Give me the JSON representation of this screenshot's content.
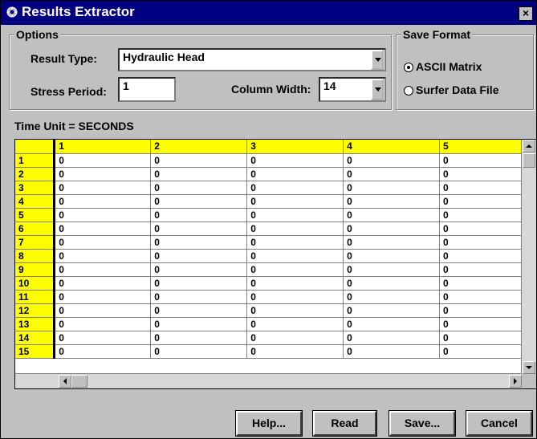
{
  "window": {
    "title": "Results Extractor",
    "close_glyph": "×"
  },
  "options": {
    "group_label": "Options",
    "result_type_label": "Result Type:",
    "result_type_value": "Hydraulic Head",
    "stress_period_label": "Stress Period:",
    "stress_period_value": "1",
    "column_width_label": "Column Width:",
    "column_width_value": "14"
  },
  "save_format": {
    "group_label": "Save Format",
    "options": [
      {
        "label": "ASCII Matrix",
        "selected": true
      },
      {
        "label": "Surfer Data File",
        "selected": false
      }
    ]
  },
  "time_unit": "Time Unit = SECONDS",
  "grid": {
    "columns": [
      "1",
      "2",
      "3",
      "4",
      "5"
    ],
    "rows": [
      {
        "label": "1",
        "values": [
          "0",
          "0",
          "0",
          "0",
          "0"
        ]
      },
      {
        "label": "2",
        "values": [
          "0",
          "0",
          "0",
          "0",
          "0"
        ]
      },
      {
        "label": "3",
        "values": [
          "0",
          "0",
          "0",
          "0",
          "0"
        ]
      },
      {
        "label": "4",
        "values": [
          "0",
          "0",
          "0",
          "0",
          "0"
        ]
      },
      {
        "label": "5",
        "values": [
          "0",
          "0",
          "0",
          "0",
          "0"
        ]
      },
      {
        "label": "6",
        "values": [
          "0",
          "0",
          "0",
          "0",
          "0"
        ]
      },
      {
        "label": "7",
        "values": [
          "0",
          "0",
          "0",
          "0",
          "0"
        ]
      },
      {
        "label": "8",
        "values": [
          "0",
          "0",
          "0",
          "0",
          "0"
        ]
      },
      {
        "label": "9",
        "values": [
          "0",
          "0",
          "0",
          "0",
          "0"
        ]
      },
      {
        "label": "10",
        "values": [
          "0",
          "0",
          "0",
          "0",
          "0"
        ]
      },
      {
        "label": "11",
        "values": [
          "0",
          "0",
          "0",
          "0",
          "0"
        ]
      },
      {
        "label": "12",
        "values": [
          "0",
          "0",
          "0",
          "0",
          "0"
        ]
      },
      {
        "label": "13",
        "values": [
          "0",
          "0",
          "0",
          "0",
          "0"
        ]
      },
      {
        "label": "14",
        "values": [
          "0",
          "0",
          "0",
          "0",
          "0"
        ]
      },
      {
        "label": "15",
        "values": [
          "0",
          "0",
          "0",
          "0",
          "0"
        ]
      }
    ]
  },
  "buttons": {
    "help": "Help...",
    "read": "Read",
    "save": "Save...",
    "cancel": "Cancel"
  },
  "colors": {
    "title_bar": "#000080",
    "header_fill": "#ffff00",
    "face": "#c0c0c0"
  }
}
